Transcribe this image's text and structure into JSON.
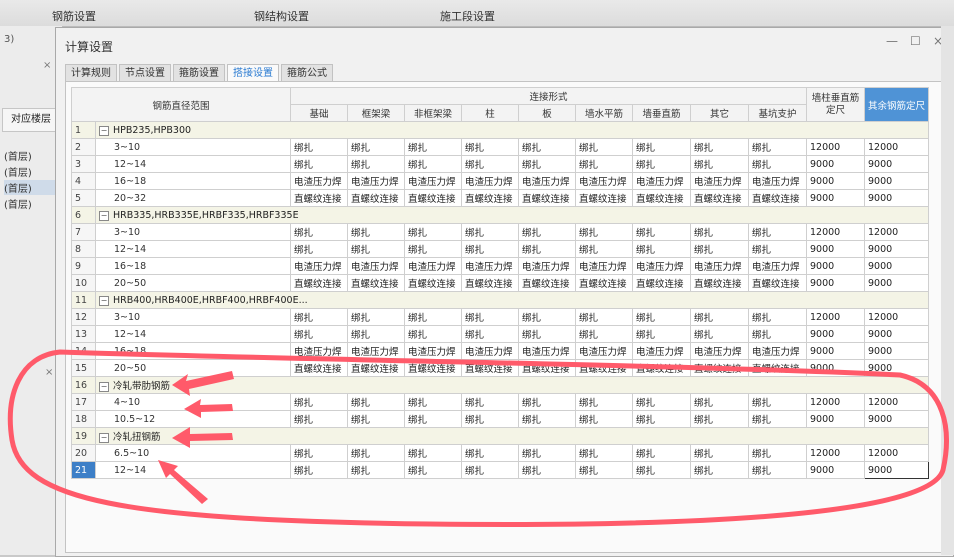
{
  "topbar": {
    "items": [
      "钢筋设置",
      "钢结构设置",
      "施工段设置"
    ]
  },
  "left_panel": {
    "number": "3)",
    "header": "对应楼层",
    "floors": [
      "(首层)",
      "(首层)",
      "(首层)",
      "(首层)"
    ],
    "close_glyph": "×",
    "close_glyph2": "×"
  },
  "dialog": {
    "title": "计算设置",
    "minimize": "—",
    "maximize": "☐",
    "close": "×",
    "tabs": [
      "计算规则",
      "节点设置",
      "箍筋设置",
      "搭接设置",
      "箍筋公式"
    ],
    "active_tab": "搭接设置"
  },
  "table": {
    "header_range": "钢筋直径范围",
    "header_connection": "连接形式",
    "header_col_wall": "墙柱垂直筋定尺",
    "header_col_other": "其余钢筋定尺",
    "columns": [
      "基础",
      "框架梁",
      "非框架梁",
      "柱",
      "板",
      "墙水平筋",
      "墙垂直筋",
      "其它",
      "基坑支护"
    ],
    "rows": [
      {
        "n": "1",
        "type": "group",
        "name": "HPB235,HPB300"
      },
      {
        "n": "2",
        "type": "row",
        "range": "3~10",
        "vals": [
          "绑扎",
          "绑扎",
          "绑扎",
          "绑扎",
          "绑扎",
          "绑扎",
          "绑扎",
          "绑扎",
          "绑扎",
          "12000",
          "12000"
        ]
      },
      {
        "n": "3",
        "type": "row",
        "range": "12~14",
        "vals": [
          "绑扎",
          "绑扎",
          "绑扎",
          "绑扎",
          "绑扎",
          "绑扎",
          "绑扎",
          "绑扎",
          "绑扎",
          "9000",
          "9000"
        ]
      },
      {
        "n": "4",
        "type": "row",
        "range": "16~18",
        "vals": [
          "电渣压力焊",
          "电渣压力焊",
          "电渣压力焊",
          "电渣压力焊",
          "电渣压力焊",
          "电渣压力焊",
          "电渣压力焊",
          "电渣压力焊",
          "电渣压力焊",
          "9000",
          "9000"
        ]
      },
      {
        "n": "5",
        "type": "row",
        "range": "20~32",
        "vals": [
          "直螺纹连接",
          "直螺纹连接",
          "直螺纹连接",
          "直螺纹连接",
          "直螺纹连接",
          "直螺纹连接",
          "直螺纹连接",
          "直螺纹连接",
          "直螺纹连接",
          "9000",
          "9000"
        ]
      },
      {
        "n": "6",
        "type": "group",
        "name": "HRB335,HRB335E,HRBF335,HRBF335E"
      },
      {
        "n": "7",
        "type": "row",
        "range": "3~10",
        "vals": [
          "绑扎",
          "绑扎",
          "绑扎",
          "绑扎",
          "绑扎",
          "绑扎",
          "绑扎",
          "绑扎",
          "绑扎",
          "12000",
          "12000"
        ]
      },
      {
        "n": "8",
        "type": "row",
        "range": "12~14",
        "vals": [
          "绑扎",
          "绑扎",
          "绑扎",
          "绑扎",
          "绑扎",
          "绑扎",
          "绑扎",
          "绑扎",
          "绑扎",
          "9000",
          "9000"
        ]
      },
      {
        "n": "9",
        "type": "row",
        "range": "16~18",
        "vals": [
          "电渣压力焊",
          "电渣压力焊",
          "电渣压力焊",
          "电渣压力焊",
          "电渣压力焊",
          "电渣压力焊",
          "电渣压力焊",
          "电渣压力焊",
          "电渣压力焊",
          "9000",
          "9000"
        ]
      },
      {
        "n": "10",
        "type": "row",
        "range": "20~50",
        "vals": [
          "直螺纹连接",
          "直螺纹连接",
          "直螺纹连接",
          "直螺纹连接",
          "直螺纹连接",
          "直螺纹连接",
          "直螺纹连接",
          "直螺纹连接",
          "直螺纹连接",
          "9000",
          "9000"
        ]
      },
      {
        "n": "11",
        "type": "group",
        "name": "HRB400,HRB400E,HRBF400,HRBF400E..."
      },
      {
        "n": "12",
        "type": "row",
        "range": "3~10",
        "vals": [
          "绑扎",
          "绑扎",
          "绑扎",
          "绑扎",
          "绑扎",
          "绑扎",
          "绑扎",
          "绑扎",
          "绑扎",
          "12000",
          "12000"
        ]
      },
      {
        "n": "13",
        "type": "row",
        "range": "12~14",
        "vals": [
          "绑扎",
          "绑扎",
          "绑扎",
          "绑扎",
          "绑扎",
          "绑扎",
          "绑扎",
          "绑扎",
          "绑扎",
          "9000",
          "9000"
        ]
      },
      {
        "n": "14",
        "type": "row",
        "range": "16~18",
        "vals": [
          "电渣压力焊",
          "电渣压力焊",
          "电渣压力焊",
          "电渣压力焊",
          "电渣压力焊",
          "电渣压力焊",
          "电渣压力焊",
          "电渣压力焊",
          "电渣压力焊",
          "9000",
          "9000"
        ]
      },
      {
        "n": "15",
        "type": "row",
        "range": "20~50",
        "vals": [
          "直螺纹连接",
          "直螺纹连接",
          "直螺纹连接",
          "直螺纹连接",
          "直螺纹连接",
          "直螺纹连接",
          "直螺纹连接",
          "直螺纹连接",
          "直螺纹连接",
          "9000",
          "9000"
        ]
      },
      {
        "n": "16",
        "type": "group",
        "name": "冷轧带肋钢筋"
      },
      {
        "n": "17",
        "type": "row",
        "range": "4~10",
        "vals": [
          "绑扎",
          "绑扎",
          "绑扎",
          "绑扎",
          "绑扎",
          "绑扎",
          "绑扎",
          "绑扎",
          "绑扎",
          "12000",
          "12000"
        ]
      },
      {
        "n": "18",
        "type": "row",
        "range": "10.5~12",
        "vals": [
          "绑扎",
          "绑扎",
          "绑扎",
          "绑扎",
          "绑扎",
          "绑扎",
          "绑扎",
          "绑扎",
          "绑扎",
          "9000",
          "9000"
        ]
      },
      {
        "n": "19",
        "type": "group",
        "name": "冷轧扭钢筋"
      },
      {
        "n": "20",
        "type": "row",
        "range": "6.5~10",
        "vals": [
          "绑扎",
          "绑扎",
          "绑扎",
          "绑扎",
          "绑扎",
          "绑扎",
          "绑扎",
          "绑扎",
          "绑扎",
          "12000",
          "12000"
        ]
      },
      {
        "n": "21",
        "type": "row",
        "range": "12~14",
        "vals": [
          "绑扎",
          "绑扎",
          "绑扎",
          "绑扎",
          "绑扎",
          "绑扎",
          "绑扎",
          "绑扎",
          "绑扎",
          "9000",
          "9000"
        ],
        "selected": true
      }
    ]
  },
  "colors": {
    "annotation": "#ff5a6a",
    "active_tab": "#2b7bd1",
    "header_highlight": "#4f93d6"
  }
}
